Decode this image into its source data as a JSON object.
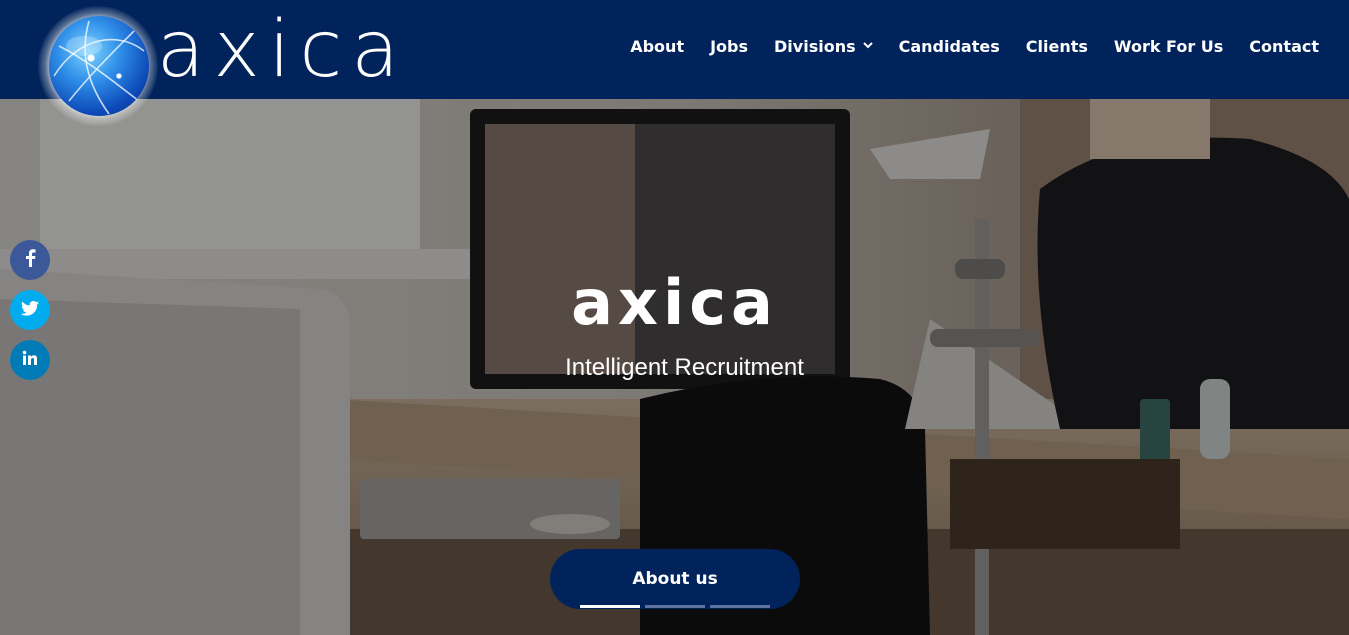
{
  "brand": {
    "logo_text": "axica",
    "header_color": "#00235b"
  },
  "nav": {
    "items": [
      {
        "label": "About"
      },
      {
        "label": "Jobs"
      },
      {
        "label": "Divisions",
        "has_dropdown": true,
        "chevron": "chevron-down-icon"
      },
      {
        "label": "Candidates"
      },
      {
        "label": "Clients"
      },
      {
        "label": "Work For Us"
      },
      {
        "label": "Contact"
      }
    ]
  },
  "hero": {
    "title": "axica",
    "subtitle": "Intelligent Recruitment",
    "cta_label": "About us",
    "slides": [
      {
        "active": true
      },
      {
        "active": false
      },
      {
        "active": false
      }
    ]
  },
  "social": [
    {
      "name": "facebook",
      "glyph": "f",
      "color": "#3b5998"
    },
    {
      "name": "twitter",
      "glyph": "🐦",
      "color": "#00aced"
    },
    {
      "name": "linkedin",
      "glyph": "in",
      "color": "#007bb6"
    }
  ],
  "chevron_glyph": "⌄"
}
